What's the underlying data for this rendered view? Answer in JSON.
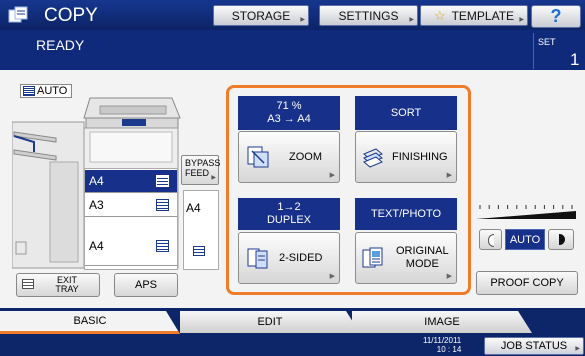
{
  "header": {
    "title": "COPY",
    "storage_label": "STORAGE",
    "settings_label": "SETTINGS",
    "template_label": "TEMPLATE",
    "help_label": "?",
    "status": "READY",
    "set_label": "SET",
    "set_value": "1",
    "colors": {
      "header_bg": "#0f2a7a",
      "accent": "#ef7c2b",
      "selected": "#17318a"
    }
  },
  "left": {
    "auto_label": "AUTO",
    "trays": [
      {
        "label": "A4",
        "selected": true
      },
      {
        "label": "A3",
        "selected": false
      },
      {
        "label": "A4",
        "selected": false
      }
    ],
    "bypass_label": "BYPASS FEED",
    "bypass_value": "A4",
    "exit_tray_label": "EXIT TRAY",
    "aps_label": "APS"
  },
  "functions": {
    "zoom": {
      "header_line1": "71 %",
      "header_line2": "A3 → A4",
      "button": "ZOOM",
      "icon": "zoom-icon"
    },
    "sort": {
      "header": "SORT",
      "button": "FINISHING",
      "icon": "finishing-icon"
    },
    "duplex": {
      "header_line1": "1→2",
      "header_line2": "DUPLEX",
      "button": "2-SIDED",
      "icon": "duplex-icon"
    },
    "mode": {
      "header": "TEXT/PHOTO",
      "button_line1": "ORIGINAL",
      "button_line2": "MODE",
      "icon": "original-mode-icon"
    }
  },
  "density": {
    "auto_label": "AUTO",
    "level_marks": 11
  },
  "proof_copy_label": "PROOF COPY",
  "tabs": [
    {
      "label": "BASIC",
      "active": true
    },
    {
      "label": "EDIT",
      "active": false
    },
    {
      "label": "IMAGE",
      "active": false
    }
  ],
  "footer": {
    "date": "11/11/2011",
    "time": "10 : 14",
    "job_status_label": "JOB STATUS"
  }
}
